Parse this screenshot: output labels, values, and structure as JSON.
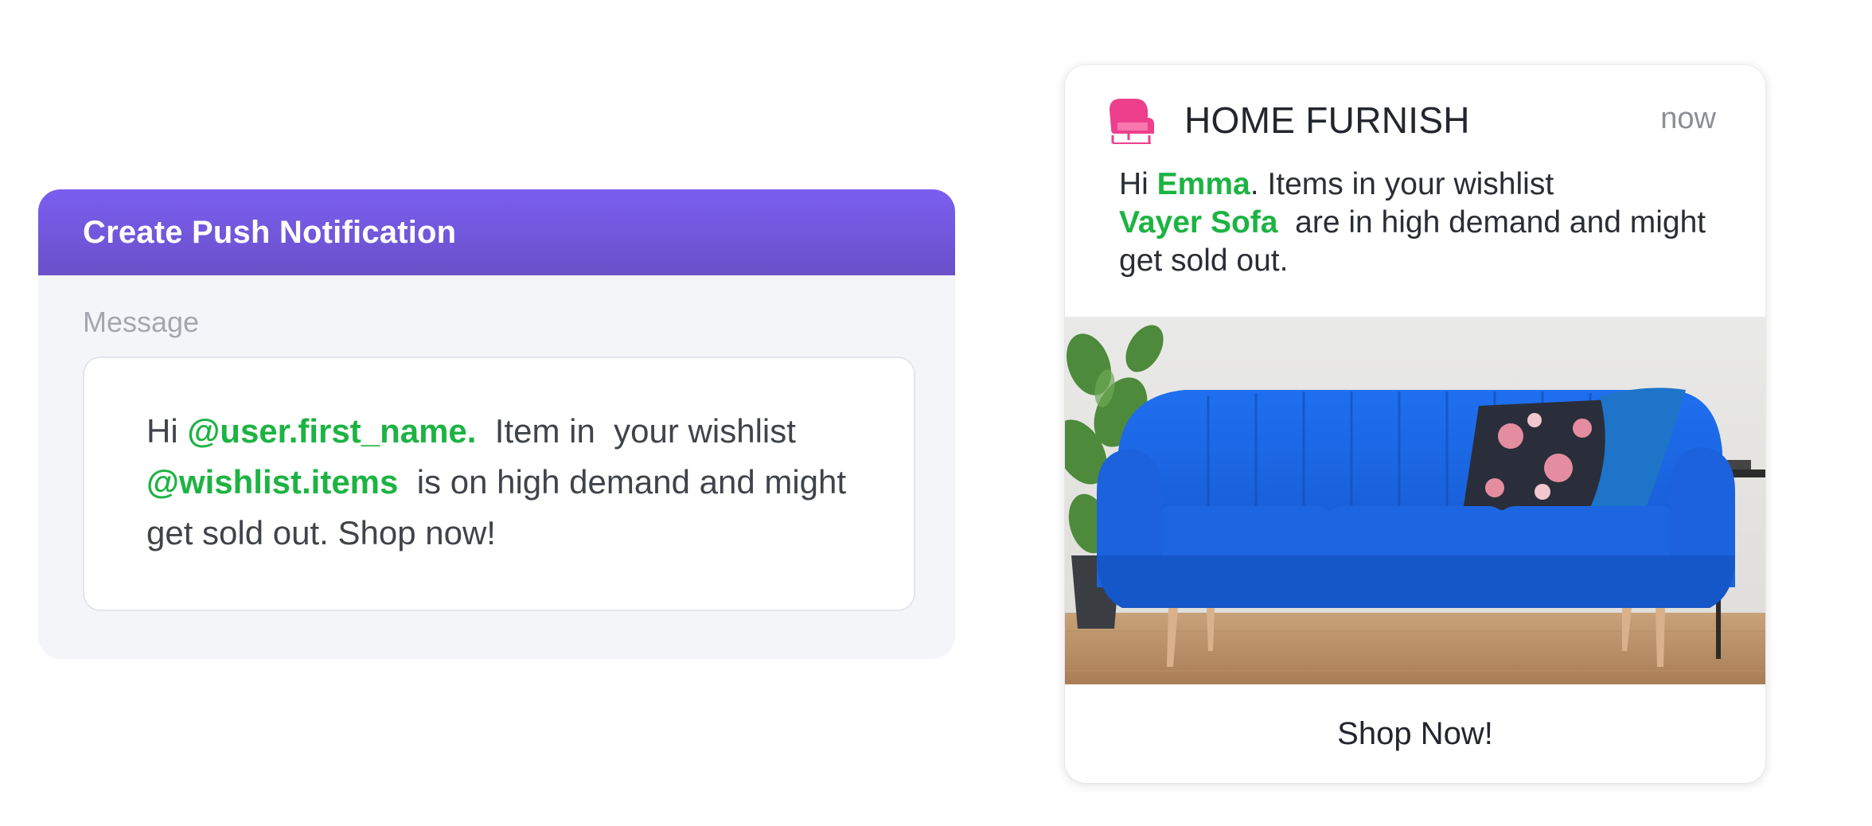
{
  "composer": {
    "title": "Create Push Notification",
    "field_label": "Message",
    "message": {
      "greeting": "Hi ",
      "token_name": "@user.first_name.",
      "text_1": "  Item in  your wishlist ",
      "token_items": "@wishlist.items",
      "text_2": "  is on high demand and might get sold out. Shop now!"
    }
  },
  "notification": {
    "app_name": "HOME FURNISH",
    "time": "now",
    "icon": "armchair-icon",
    "body": {
      "greeting": "Hi ",
      "name": "Emma",
      "text_1": ". Items in your wishlist ",
      "item": "Vayer Sofa",
      "text_2": "  are in high demand and might get sold out."
    },
    "image": "blue-sofa-photo",
    "cta_label": "Shop Now!"
  },
  "colors": {
    "header_purple": "#7a5ef0",
    "token_green": "#1db343",
    "icon_pink": "#ee3f8d",
    "sofa_blue": "#1a66e6"
  }
}
